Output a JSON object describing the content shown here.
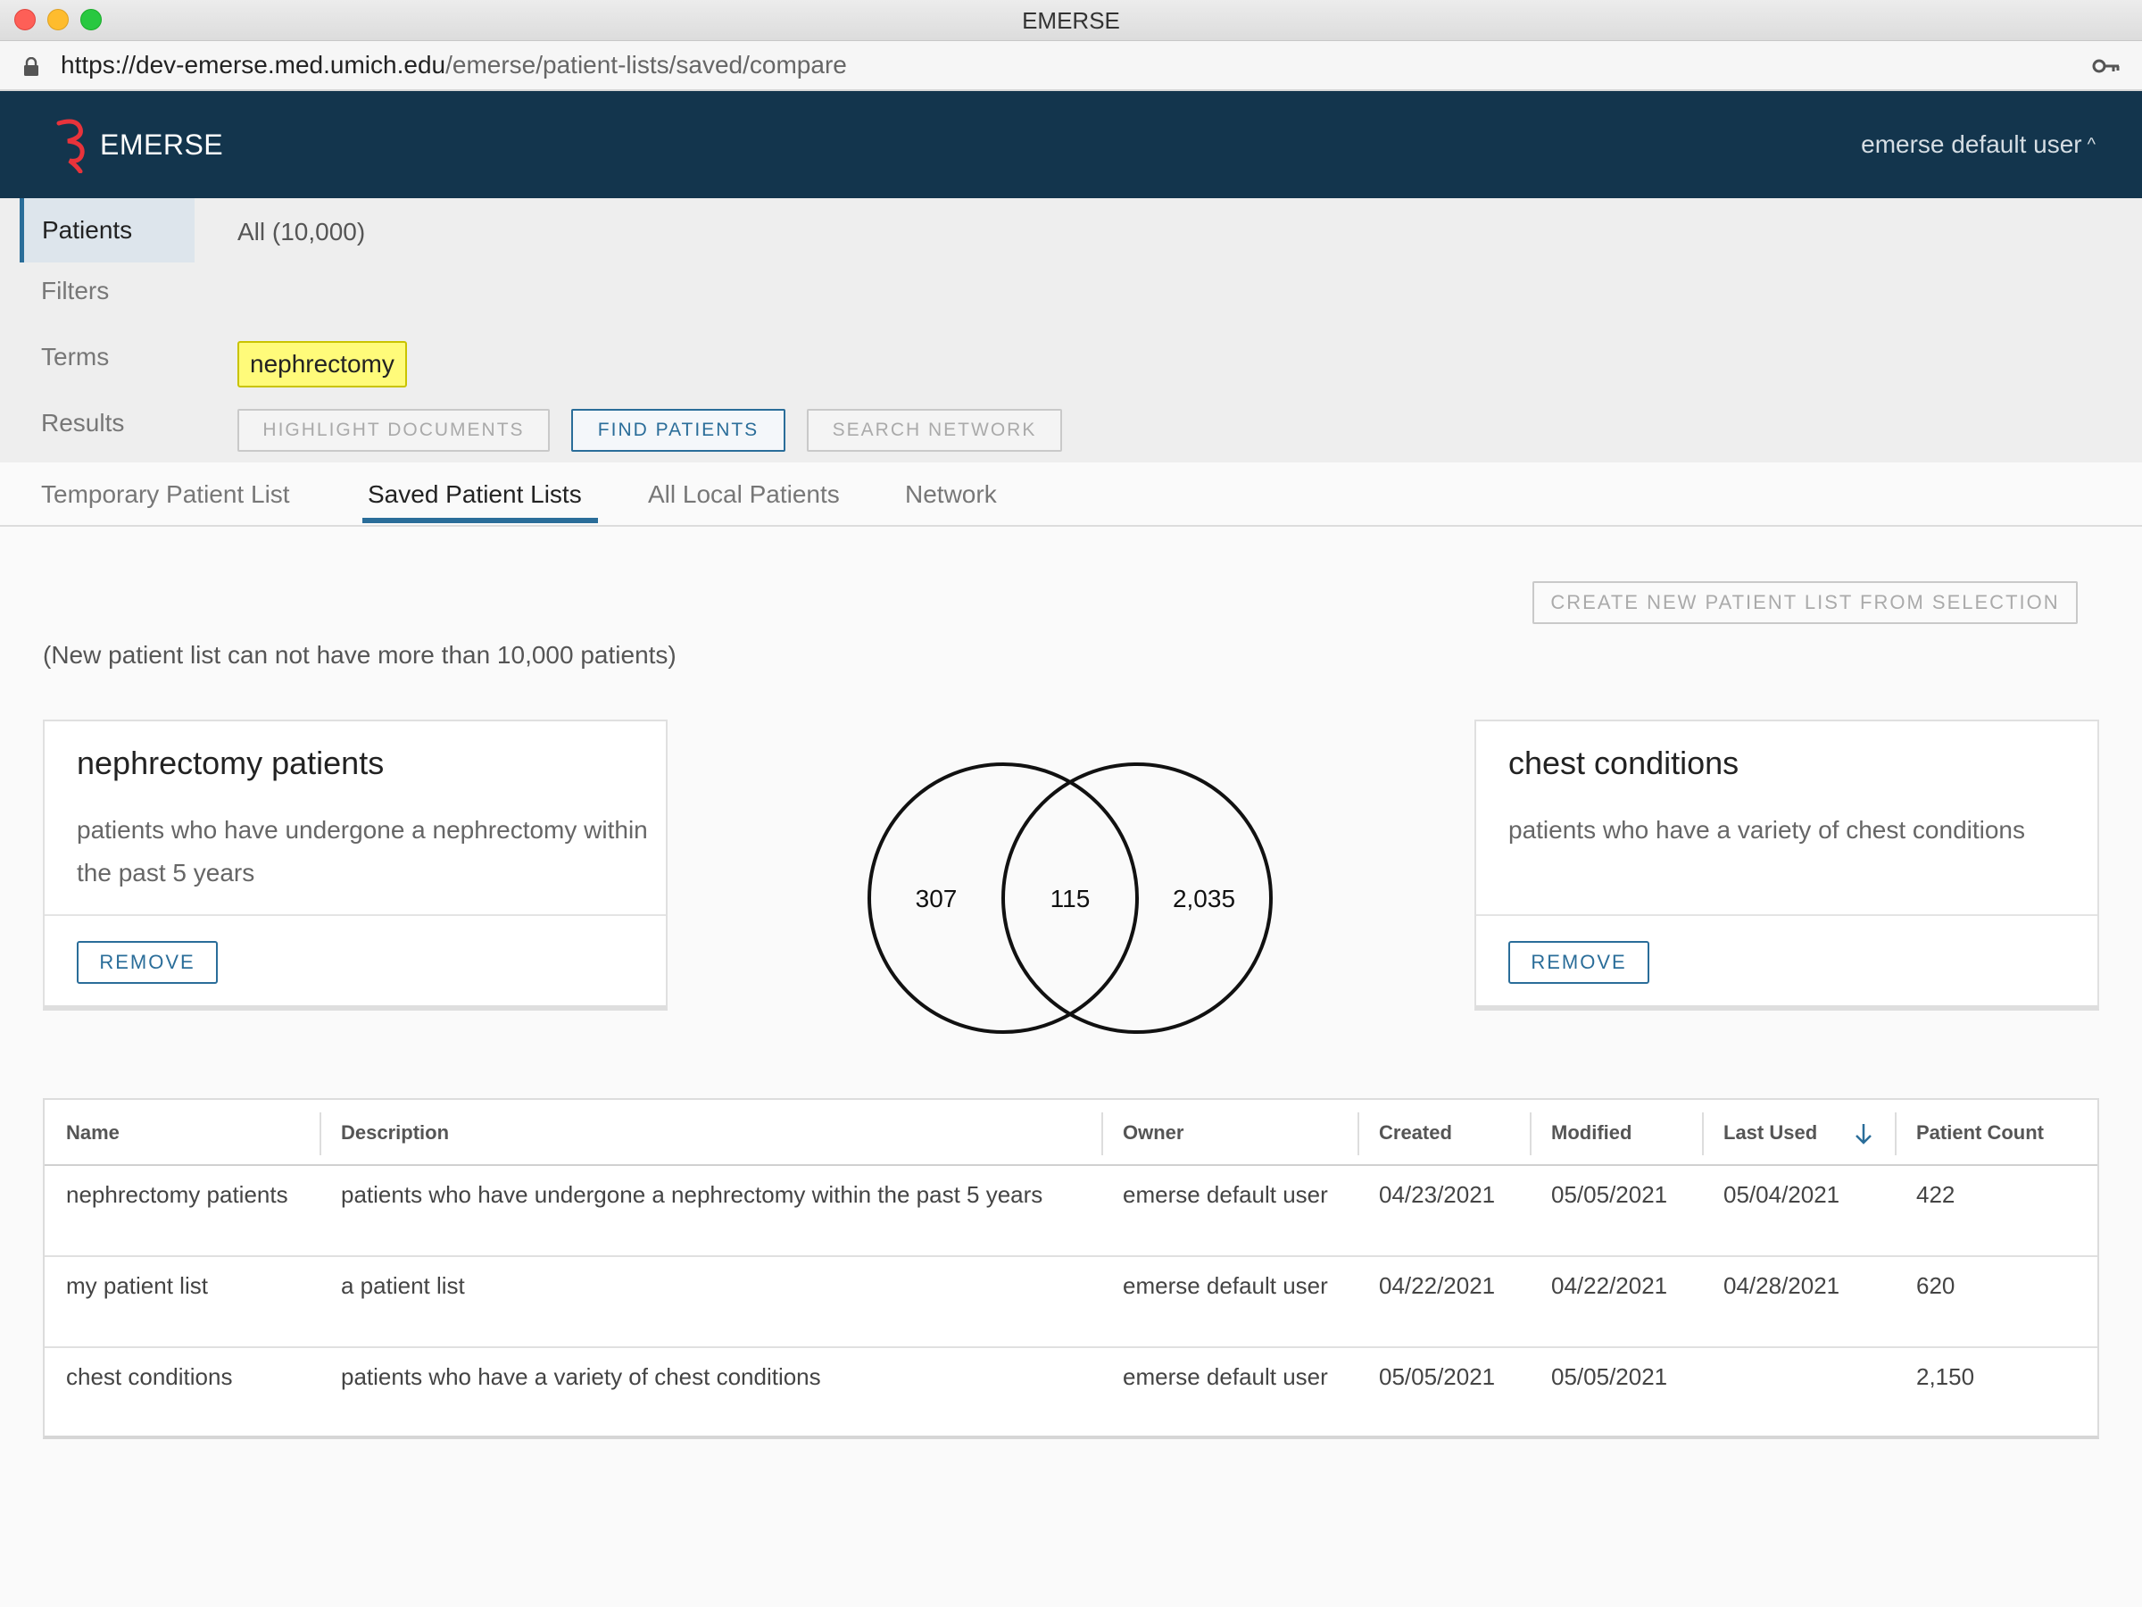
{
  "window": {
    "title": "EMERSE"
  },
  "browser": {
    "url_host": "https://dev-emerse.med.umich.edu",
    "url_path": "/emerse/patient-lists/saved/compare"
  },
  "header": {
    "brand": "EMERSE",
    "user": "emerse default user"
  },
  "query": {
    "patients_label": "Patients",
    "patients_value": "All (10,000)",
    "filters_label": "Filters",
    "terms_label": "Terms",
    "term": "nephrectomy",
    "results_label": "Results",
    "buttons": {
      "highlight": "HIGHLIGHT DOCUMENTS",
      "find": "FIND PATIENTS",
      "network": "SEARCH NETWORK"
    }
  },
  "tabs": [
    "Temporary Patient List",
    "Saved Patient Lists",
    "All Local Patients",
    "Network"
  ],
  "active_tab": "Saved Patient Lists",
  "content": {
    "create_button": "CREATE NEW PATIENT LIST FROM SELECTION",
    "note": "(New patient list can not have more than 10,000 patients)"
  },
  "cards": [
    {
      "title": "nephrectomy patients",
      "description": "patients who have undergone a nephrectomy within the past 5 years",
      "remove": "REMOVE"
    },
    {
      "title": "chest conditions",
      "description": "patients who have a variety of chest conditions",
      "remove": "REMOVE"
    }
  ],
  "venn": {
    "left_only": "307",
    "overlap": "115",
    "right_only": "2,035"
  },
  "table": {
    "columns": [
      "Name",
      "Description",
      "Owner",
      "Created",
      "Modified",
      "Last Used",
      "Patient Count"
    ],
    "sort_column": "Last Used",
    "rows": [
      {
        "name": "nephrectomy patients",
        "description": "patients who have undergone a nephrectomy within the past 5 years",
        "owner": "emerse default user",
        "created": "04/23/2021",
        "modified": "05/05/2021",
        "last_used": "05/04/2021",
        "count": "422"
      },
      {
        "name": "my patient list",
        "description": "a patient list",
        "owner": "emerse default user",
        "created": "04/22/2021",
        "modified": "04/22/2021",
        "last_used": "04/28/2021",
        "count": "620"
      },
      {
        "name": "chest conditions",
        "description": "patients who have a variety of chest conditions",
        "owner": "emerse default user",
        "created": "05/05/2021",
        "modified": "05/05/2021",
        "last_used": "",
        "count": "2,150"
      }
    ]
  },
  "colors": {
    "header_bg": "#13354d",
    "accent": "#2a6d99",
    "term_highlight": "#fffb7a",
    "logo": "#e8333b"
  },
  "icons": {
    "lock": "lock-icon",
    "key": "key-icon",
    "logo": "emerse-logo-icon",
    "user_chevron": "chevron-up-icon",
    "sort": "arrow-down-icon"
  }
}
